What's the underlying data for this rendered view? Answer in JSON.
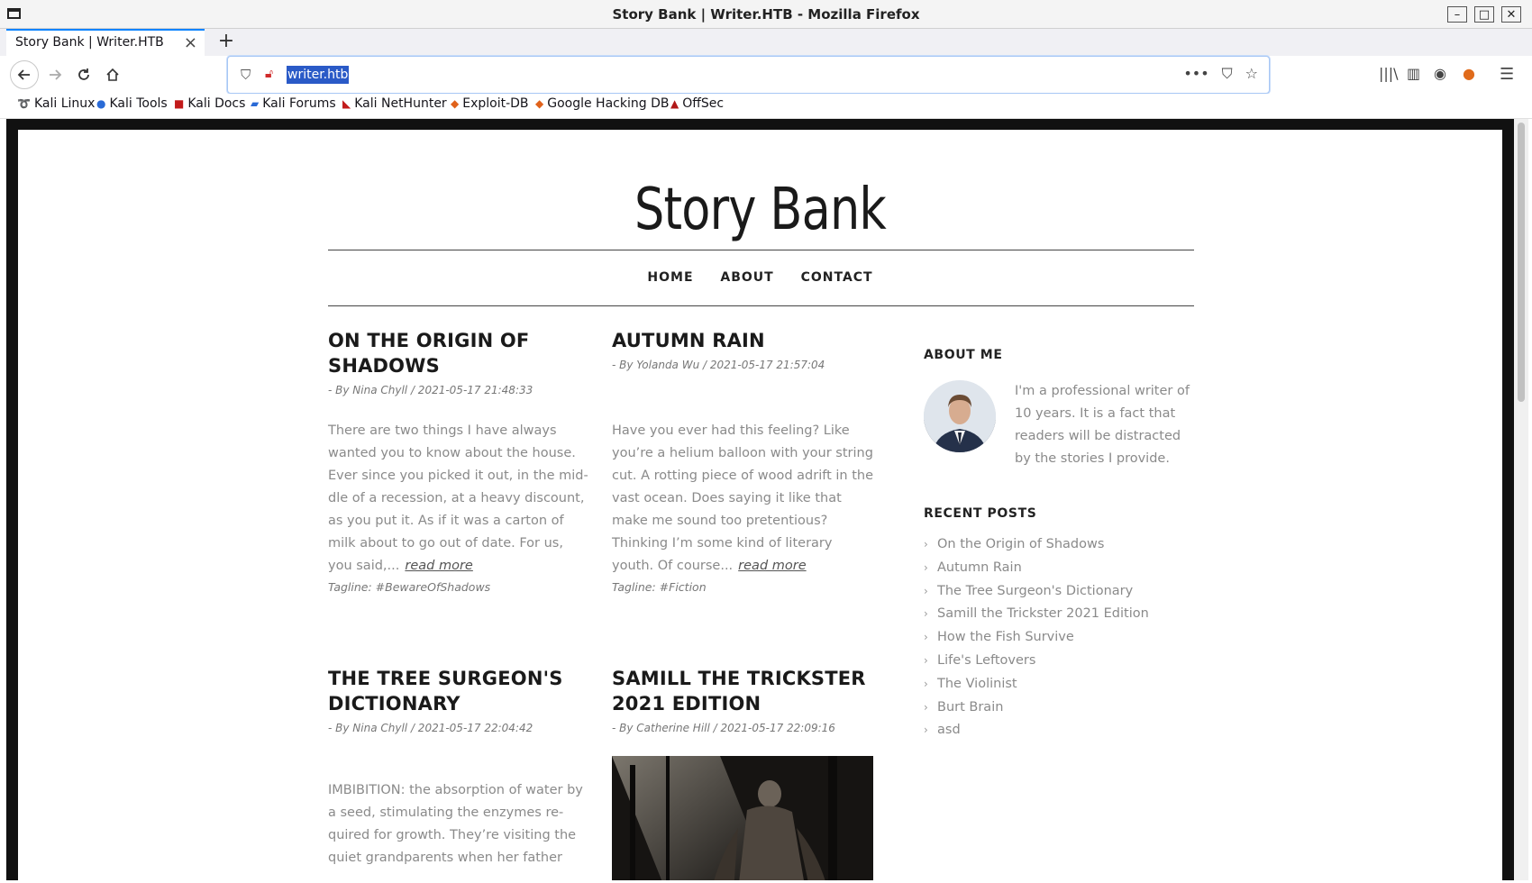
{
  "window": {
    "title": "Story Bank | Writer.HTB - Mozilla Firefox",
    "controls": {
      "minimize": "–",
      "maximize": "□",
      "close": "✕"
    }
  },
  "browser": {
    "tab_title": "Story Bank | Writer.HTB",
    "tab_close": "×",
    "new_tab": "+",
    "url": "writer.htb",
    "page_actions": [
      "•••",
      "⛉",
      "☆"
    ],
    "bookmarks": [
      {
        "label": "Kali Linux",
        "icon": "kali-dragon-icon",
        "glyph": "➰"
      },
      {
        "label": "Kali Tools",
        "icon": "kali-tools-icon",
        "glyph": "●"
      },
      {
        "label": "Kali Docs",
        "icon": "kali-docs-icon",
        "glyph": "■"
      },
      {
        "label": "Kali Forums",
        "icon": "kali-forums-icon",
        "glyph": "▰"
      },
      {
        "label": "Kali NetHunter",
        "icon": "nethunter-icon",
        "glyph": "◣"
      },
      {
        "label": "Exploit-DB",
        "icon": "exploit-db-icon",
        "glyph": "◆"
      },
      {
        "label": "Google Hacking DB",
        "icon": "ghdb-icon",
        "glyph": "◆"
      },
      {
        "label": "OffSec",
        "icon": "offsec-icon",
        "glyph": "▲"
      }
    ]
  },
  "site": {
    "title": "Story Bank",
    "nav": [
      "HOME",
      "ABOUT",
      "CONTACT"
    ],
    "posts": [
      {
        "title": "ON THE ORIGIN OF SHADOWS",
        "meta": "- By Nina Chyll / 2021-05-17 21:48:33",
        "excerpt": "There are two things I have always wanted you to know about the house. Ever since you picked it out, in the mid­dle of a recession, at a heavy discount, as you put it. As if it was a carton of milk about to go out of date. For us, you said,...",
        "read_more": "read more",
        "tagline": "Tagline: #BewareOfShadows"
      },
      {
        "title": "AUTUMN RAIN",
        "meta": "- By Yolanda Wu / 2021-05-17 21:57:04",
        "excerpt": "Have you ever had this feeling? Like you’re a helium balloon with your string cut. A rotting piece of wood adrift in the vast ocean. Does saying it like that make me sound too pretentious? Thinking I’m some kind of literary youth. Of course...",
        "read_more": "read more",
        "tagline": "Tagline: #Fiction"
      },
      {
        "title": "THE TREE SURGEON'S DICTIONARY",
        "meta": "- By Nina Chyll / 2021-05-17 22:04:42",
        "excerpt": "IMBIBITION: the absorption of water by a seed, stimulating the enzymes re­quired for growth. They’re visiting the quiet grandparents when her father"
      },
      {
        "title": "SAMILL THE TRICKSTER 2021 EDITION",
        "meta": "- By Catherine Hill / 2021-05-17 22:09:16"
      }
    ],
    "sidebar": {
      "about_heading": "ABOUT ME",
      "about_text": "I'm a professional writer of 10 years. It is a fact that readers will be distracted by the stories I provide.",
      "recent_heading": "RECENT POSTS",
      "recent_posts": [
        "On the Origin of Shadows",
        "Autumn Rain",
        "The Tree Surgeon's Dictionary",
        "Samill the Trickster 2021 Edition",
        "How the Fish Survive",
        "Life's Leftovers",
        "The Violinist",
        "Burt Brain",
        "asd"
      ]
    }
  }
}
